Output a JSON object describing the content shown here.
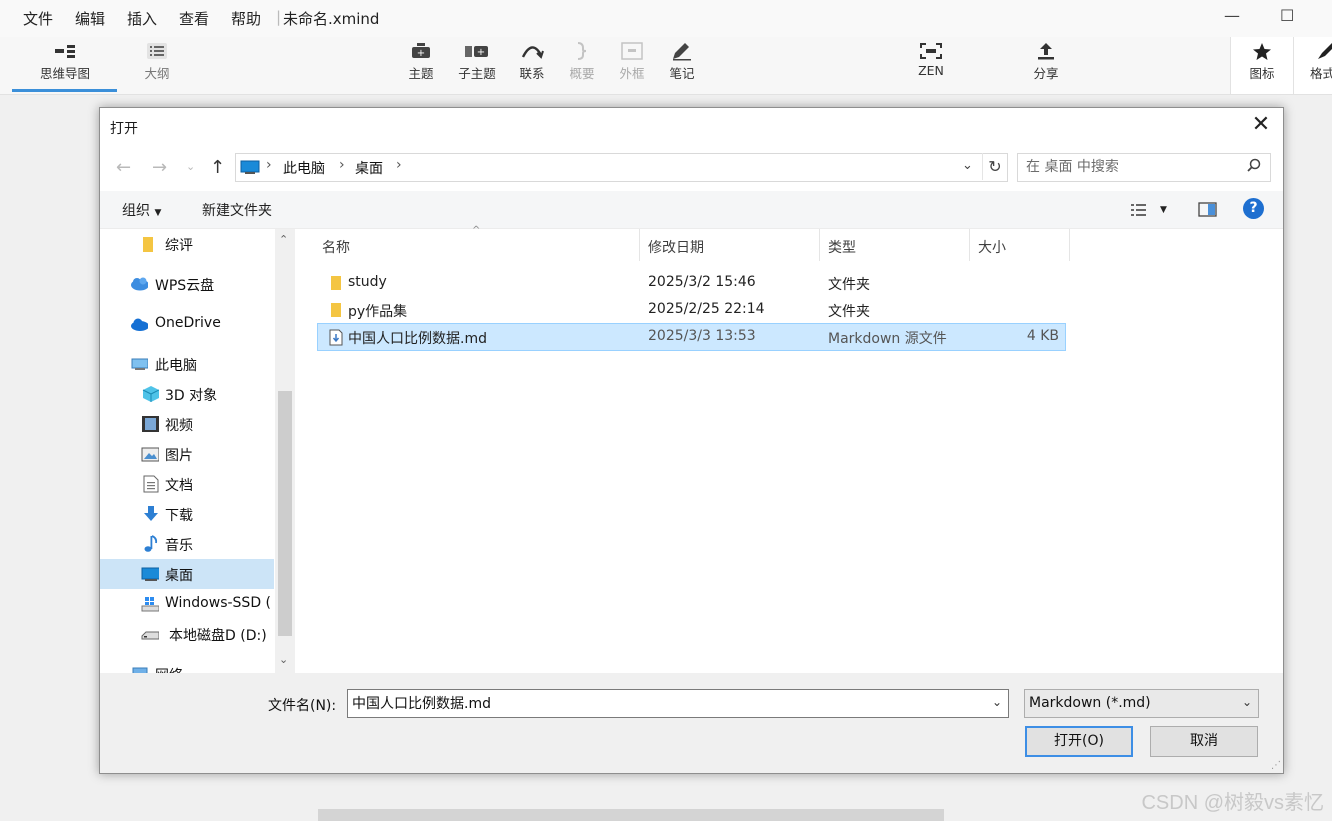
{
  "app": {
    "menus": [
      "文件",
      "编辑",
      "插入",
      "查看",
      "帮助"
    ],
    "doc_title": "未命名.xmind",
    "window_controls": {
      "minimize": "—",
      "maximize": "☐"
    }
  },
  "toolbar": {
    "views": {
      "mindmap": "思维导图",
      "outline": "大纲"
    },
    "tools": {
      "topic": "主题",
      "subtopic": "子主题",
      "relationship": "联系",
      "summary": "概要",
      "boundary": "外框",
      "note": "笔记",
      "zen": "ZEN",
      "share": "分享",
      "icon": "图标",
      "format": "格式"
    },
    "disabled": [
      "summary",
      "boundary"
    ]
  },
  "dialog": {
    "title": "打开",
    "breadcrumb": [
      "此电脑",
      "桌面"
    ],
    "search_placeholder": "在 桌面 中搜索",
    "commands": {
      "organize": "组织",
      "new_folder": "新建文件夹"
    },
    "nav_items": [
      {
        "label": "综评",
        "icon": "folder-icon"
      },
      {
        "label": "WPS云盘",
        "icon": "cloud-icon"
      },
      {
        "label": "OneDrive",
        "icon": "onedrive-icon"
      },
      {
        "label": "此电脑",
        "icon": "computer-icon"
      },
      {
        "label": "3D 对象",
        "icon": "cube-icon"
      },
      {
        "label": "视频",
        "icon": "video-icon"
      },
      {
        "label": "图片",
        "icon": "picture-icon"
      },
      {
        "label": "文档",
        "icon": "document-icon"
      },
      {
        "label": "下载",
        "icon": "download-icon"
      },
      {
        "label": "音乐",
        "icon": "music-icon"
      },
      {
        "label": "桌面",
        "icon": "desktop-icon",
        "selected": true
      },
      {
        "label": "Windows-SSD (",
        "icon": "windows-drive-icon"
      },
      {
        "label": "本地磁盘D (D:)",
        "icon": "drive-icon"
      },
      {
        "label": "网络",
        "icon": "network-icon"
      }
    ],
    "columns": {
      "name": "名称",
      "modified": "修改日期",
      "type": "类型",
      "size": "大小"
    },
    "files": [
      {
        "name": "study",
        "modified": "2025/3/2 15:46",
        "type": "文件夹",
        "size": "",
        "icon": "folder-icon"
      },
      {
        "name": "py作品集",
        "modified": "2025/2/25 22:14",
        "type": "文件夹",
        "size": "",
        "icon": "folder-icon"
      },
      {
        "name": "中国人口比例数据.md",
        "modified": "2025/3/3 13:53",
        "type": "Markdown 源文件",
        "size": "4 KB",
        "icon": "markdown-file-icon",
        "selected": true
      }
    ],
    "filename_label": "文件名(N):",
    "filename_value": "中国人口比例数据.md",
    "filetype_value": "Markdown (*.md)",
    "open_button": "打开(O)",
    "cancel_button": "取消"
  },
  "watermark": "CSDN @树毅vs素忆",
  "colors": {
    "accent": "#3b8fd9",
    "selection": "#cce8ff",
    "nav_selection": "#cce4f7",
    "help": "#1e6fd0",
    "folder": "#f4c542"
  }
}
